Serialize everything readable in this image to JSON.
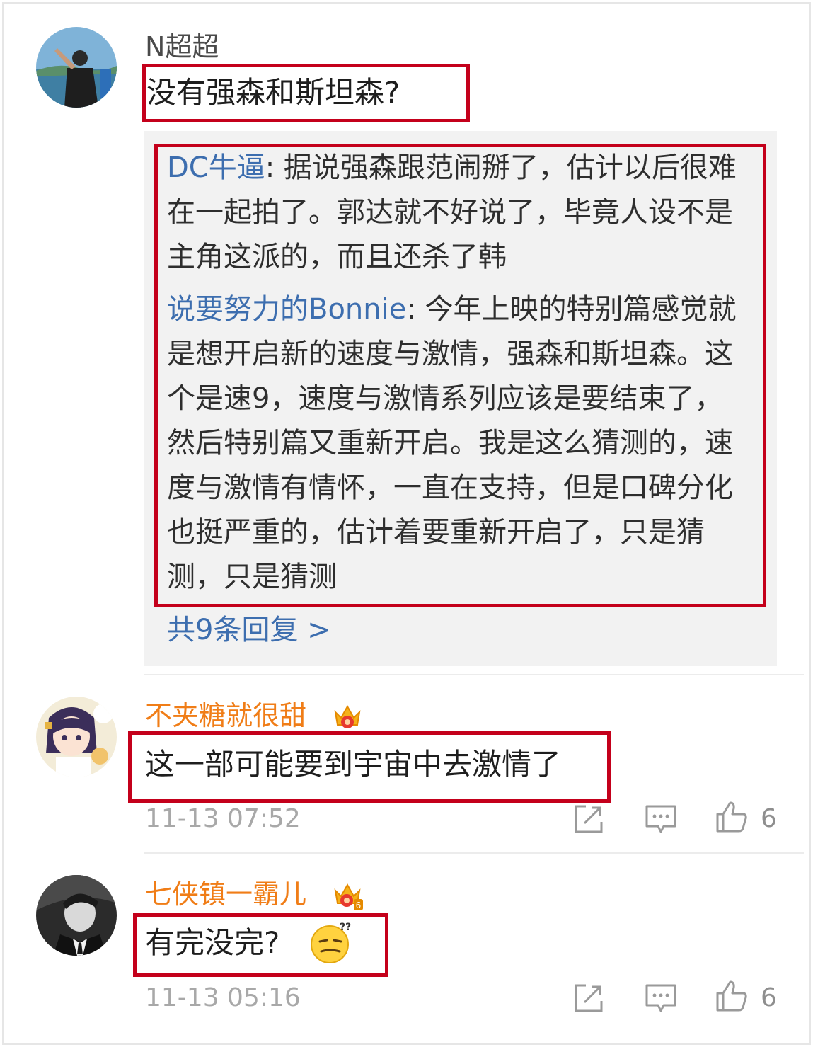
{
  "colors": {
    "link_blue": "#3d6eaf",
    "username_orange": "#f07d17",
    "highlight_red": "#c4001b",
    "reply_bg": "#f2f2f2",
    "meta_gray": "#a8a8a8"
  },
  "comments": [
    {
      "username": "N超超",
      "text": "没有强森和斯坦森?",
      "replies": [
        {
          "name": "DC牛逼",
          "text": ": 据说强森跟范闹掰了，估计以后很难在一起拍了。郭达就不好说了，毕竟人设不是主角这派的，而且还杀了韩"
        },
        {
          "name": "说要努力的Bonnie",
          "text": ": 今年上映的特别篇感觉就是想开启新的速度与激情，强森和斯坦森。这个是速9，速度与激情系列应该是要结束了，然后特别篇又重新开启。我是这么猜测的，速度与激情有情怀，一直在支持，但是口碑分化也挺严重的，估计着要重新开启了，只是猜测，只是猜测"
        }
      ],
      "more_replies": "共9条回复 >"
    },
    {
      "username": "不夹糖就很甜",
      "badge_icon": "vip-crown-icon",
      "text": "这一部可能要到宇宙中去激情了",
      "time": "11-13 07:52",
      "likes": "6"
    },
    {
      "username": "七侠镇一霸儿",
      "badge_icon": "vip-crown-icon",
      "badge_level": "6",
      "text": "有完没完?",
      "emoji": "confused-face-emoji",
      "time": "11-13 05:16",
      "likes": "6"
    }
  ]
}
